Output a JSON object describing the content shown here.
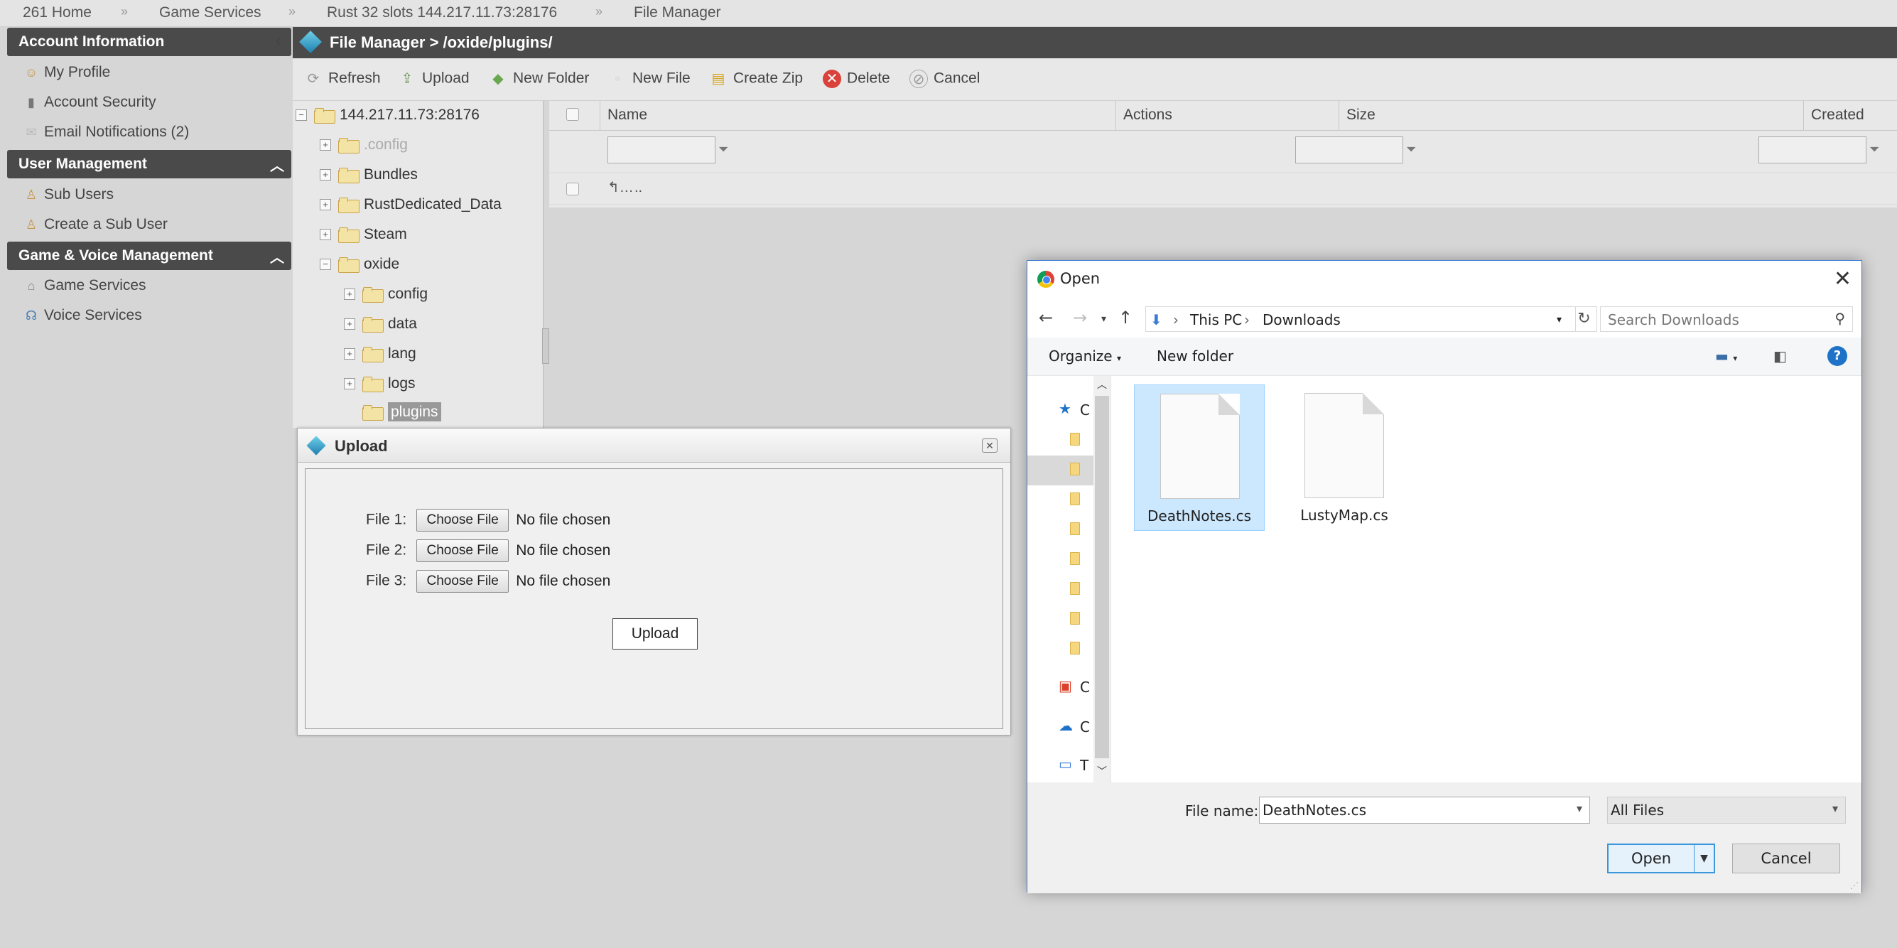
{
  "breadcrumb": [
    "261 Home",
    "Game Services",
    "Rust 32 slots 144.217.11.73:28176",
    "File Manager"
  ],
  "breadcrumb_sep": "»",
  "sidebar": {
    "account": {
      "title": "Account Information",
      "items": [
        "My Profile",
        "Account Security",
        "Email Notifications (2)"
      ]
    },
    "users": {
      "title": "User Management",
      "items": [
        "Sub Users",
        "Create a Sub User"
      ]
    },
    "game": {
      "title": "Game & Voice Management",
      "items": [
        "Game Services",
        "Voice Services"
      ]
    }
  },
  "file_manager": {
    "title": "File Manager > /oxide/plugins/",
    "toolbar": [
      "Refresh",
      "Upload",
      "New Folder",
      "New File",
      "Create Zip",
      "Delete",
      "Cancel"
    ],
    "tree": {
      "root": "144.217.11.73:28176",
      "nodes": [
        ".config",
        "Bundles",
        "RustDedicated_Data",
        "Steam",
        "oxide"
      ],
      "oxide_children": [
        "config",
        "data",
        "lang",
        "logs",
        "plugins"
      ]
    },
    "columns": [
      "Name",
      "Actions",
      "Size",
      "Created"
    ],
    "parent_row": ".."
  },
  "upload_dialog": {
    "title": "Upload",
    "rows": [
      {
        "label": "File 1:",
        "button": "Choose File",
        "status": "No file chosen"
      },
      {
        "label": "File 2:",
        "button": "Choose File",
        "status": "No file chosen"
      },
      {
        "label": "File 3:",
        "button": "Choose File",
        "status": "No file chosen"
      }
    ],
    "submit": "Upload"
  },
  "open_dialog": {
    "title": "Open",
    "path": [
      "This PC",
      "Downloads"
    ],
    "search_placeholder": "Search Downloads",
    "organize": "Organize",
    "new_folder": "New folder",
    "nav_letters": [
      "C",
      "C",
      "C",
      "T"
    ],
    "files": [
      {
        "name": "DeathNotes.cs",
        "selected": true
      },
      {
        "name": "LustyMap.cs",
        "selected": false
      }
    ],
    "file_name_label": "File name:",
    "file_name_value": "DeathNotes.cs",
    "file_type": "All Files",
    "open_button": "Open",
    "cancel_button": "Cancel"
  },
  "colors": {
    "dark_header": "#4a4a4a",
    "selection": "#cce8ff",
    "accent_blue": "#3c96dc"
  }
}
